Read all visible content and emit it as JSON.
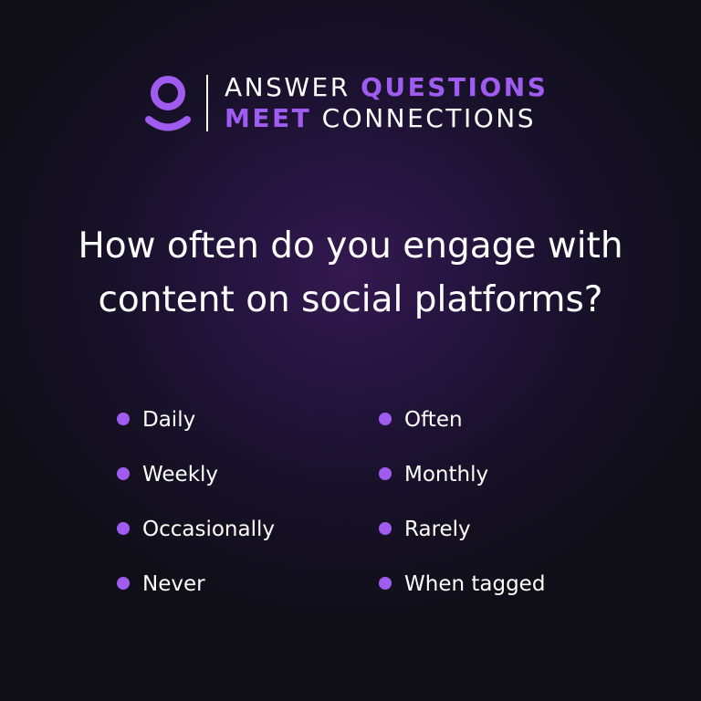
{
  "header": {
    "line1": {
      "regular": "ANSWER",
      "accent": "QUESTIONS"
    },
    "line2": {
      "accent": "MEET",
      "regular": "CONNECTIONS"
    },
    "logo_icon": "user-profile-icon"
  },
  "question": {
    "line1": "How often do you engage with",
    "line2": "content on social platforms?"
  },
  "options": {
    "left": [
      "Daily",
      "Weekly",
      "Occasionally",
      "Never"
    ],
    "right": [
      "Often",
      "Monthly",
      "Rarely",
      "When tagged"
    ]
  },
  "colors": {
    "accent": "#a05cf0",
    "text": "#ffffff",
    "background": "#100f18",
    "glow": "#34194f"
  }
}
